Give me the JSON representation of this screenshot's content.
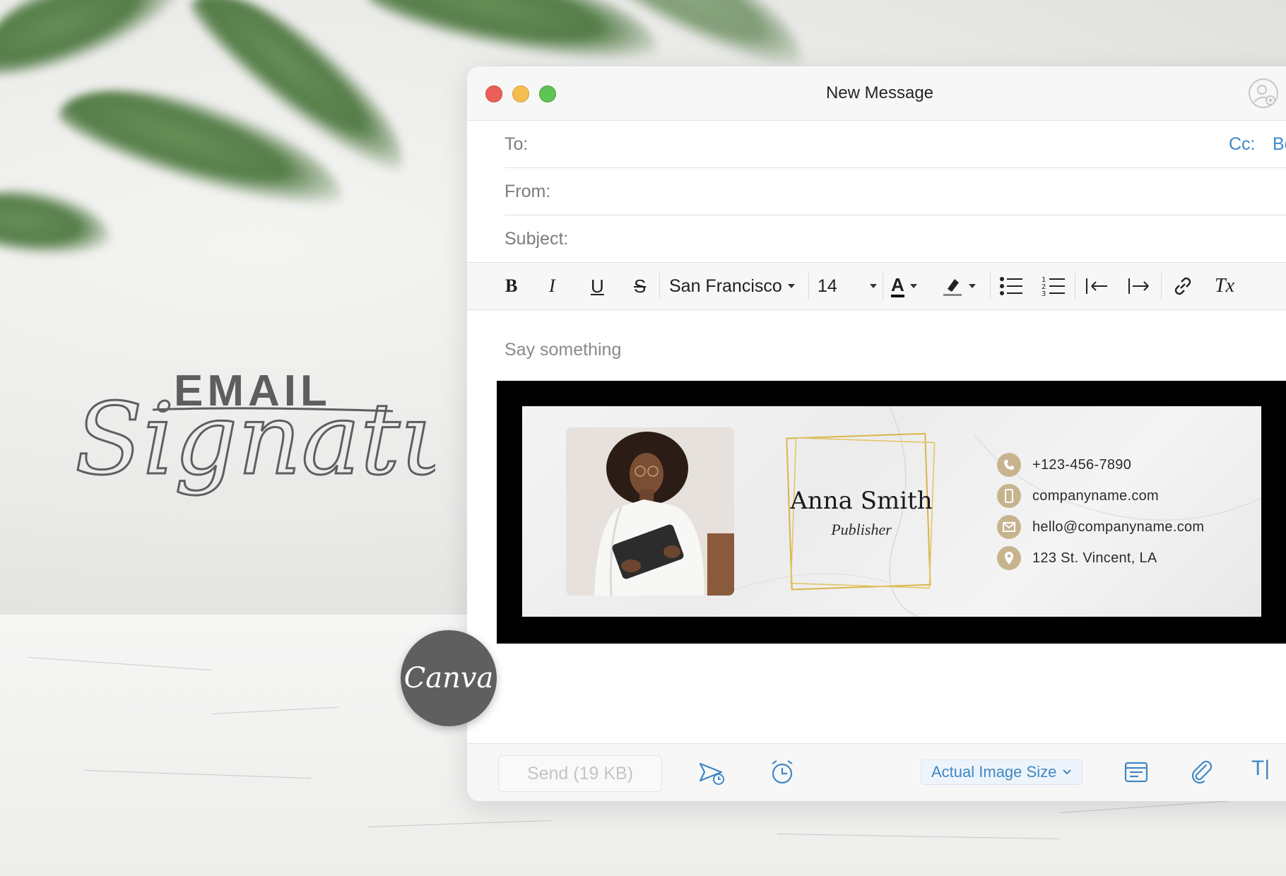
{
  "hero": {
    "word1": "EMAIL",
    "word2": "Signature"
  },
  "window": {
    "title": "New Message",
    "fields": {
      "to_label": "To:",
      "from_label": "From:",
      "subject_label": "Subject:",
      "cc_label": "Cc:",
      "bcc_label": "Bcc:"
    },
    "toolbar": {
      "bold": "B",
      "italic": "I",
      "underline": "U",
      "strike": "S",
      "font_name": "San Francisco",
      "font_size": "14",
      "text_color_glyph": "A",
      "clear_format_glyph": "Tx"
    },
    "body": {
      "placeholder": "Say something"
    },
    "bottom": {
      "send_label": "Send (19 KB)",
      "image_size_label": "Actual Image Size",
      "text_cursor_glyph": "T|"
    }
  },
  "signature": {
    "name": "Anna Smith",
    "role": "Publisher",
    "contacts": [
      {
        "icon": "phone-icon",
        "text": "+123-456-7890"
      },
      {
        "icon": "mobile-icon",
        "text": "companyname.com"
      },
      {
        "icon": "mail-icon",
        "text": "hello@companyname.com"
      },
      {
        "icon": "location-icon",
        "text": "123 St. Vincent, LA"
      }
    ],
    "accent_color": "#c7b48f",
    "frame_gold": "#d9b54a"
  },
  "badge": {
    "label": "Canva"
  },
  "colors": {
    "link_blue": "#3f88c5",
    "traffic_red": "#ec5f58",
    "traffic_yellow": "#f4bd4f",
    "traffic_green": "#5fc454"
  }
}
